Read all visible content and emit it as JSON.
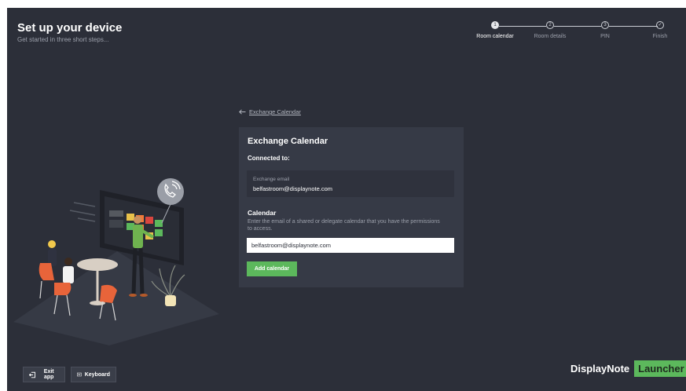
{
  "header": {
    "title": "Set up your device",
    "subtitle": "Get started in three short steps..."
  },
  "stepper": {
    "steps": [
      {
        "label": "Room calendar",
        "number": "1",
        "state": "active"
      },
      {
        "label": "Room details",
        "number": "2",
        "state": "pending"
      },
      {
        "label": "PIN",
        "number": "3",
        "state": "pending"
      },
      {
        "label": "Finish",
        "number": "✓",
        "state": "pending"
      }
    ]
  },
  "back_link": {
    "label": "Exchange Calendar",
    "icon": "arrow-left-icon"
  },
  "card": {
    "title": "Exchange Calendar",
    "connected_label": "Connected to:",
    "email_box": {
      "label": "Exchange email",
      "value": "belfastroom@displaynote.com"
    },
    "calendar": {
      "label": "Calendar",
      "help": "Enter the email of a shared or delegate calendar that you have the permissions to access.",
      "input_value": "belfastroom@displaynote.com"
    },
    "add_button_label": "Add calendar"
  },
  "footer": {
    "exit_label": "Exit app",
    "exit_icon": "exit-icon",
    "keyboard_label": "Keyboard",
    "keyboard_icon": "keyboard-icon"
  },
  "brand": {
    "name": "DisplayNote",
    "tag": "Launcher"
  },
  "colors": {
    "background": "#2c2f39",
    "card": "#363a46",
    "accent_green": "#5cb85c"
  }
}
